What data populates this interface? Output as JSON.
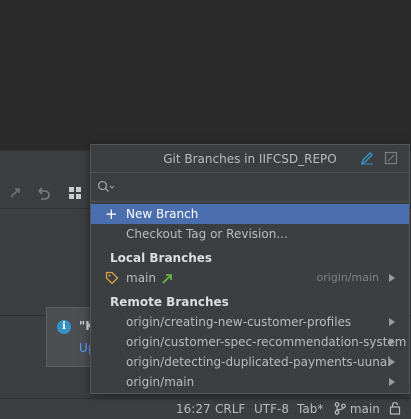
{
  "popup": {
    "title": "Git Branches in IIFCSD_REPO",
    "search_placeholder": "",
    "new_branch": "New Branch",
    "checkout_tag": "Checkout Tag or Revision...",
    "local_header": "Local Branches",
    "local_branches": [
      {
        "name": "main",
        "tracking": "origin/main"
      }
    ],
    "remote_header": "Remote Branches",
    "remote_branches": [
      {
        "name": "origin/creating-new-customer-profiles"
      },
      {
        "name": "origin/customer-spec-recommendation-system"
      },
      {
        "name": "origin/detecting-duplicated-payments-uunal"
      },
      {
        "name": "origin/main"
      }
    ],
    "icons": {
      "edit": "pencil-icon",
      "settings": "window-icon",
      "search": "search-icon"
    }
  },
  "notification": {
    "title": "\"K",
    "link": "Up"
  },
  "statusbar": {
    "position": "16:27",
    "line_separator": "CRLF",
    "encoding": "UTF-8",
    "indent": "Tab*",
    "branch": "main"
  },
  "colors": {
    "selection": "#4b6eaf",
    "accent_link": "#589df6",
    "arrow_green": "#62b543",
    "tag_orange": "#d9a343"
  }
}
